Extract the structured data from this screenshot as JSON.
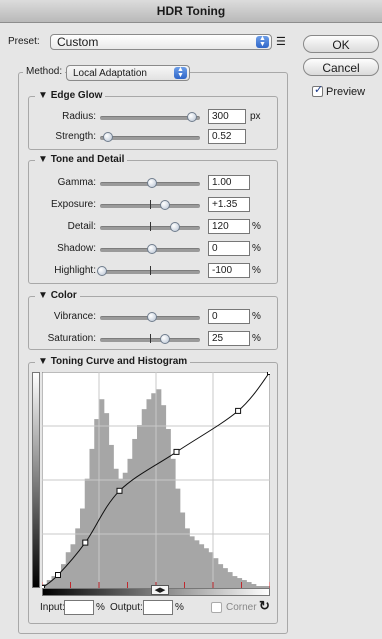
{
  "window": {
    "title": "HDR Toning"
  },
  "preset": {
    "label": "Preset:",
    "value": "Custom",
    "menu_icon": "list-menu-icon"
  },
  "buttons": {
    "ok": "OK",
    "cancel": "Cancel"
  },
  "preview": {
    "label": "Preview",
    "checked": true
  },
  "method": {
    "label": "Method:",
    "value": "Local Adaptation"
  },
  "edge_glow": {
    "title": "Edge Glow",
    "radius": {
      "label": "Radius:",
      "value": "300",
      "unit": "px",
      "slider_fraction": 0.9
    },
    "strength": {
      "label": "Strength:",
      "value": "0.52",
      "unit": "",
      "slider_fraction": 0.05
    }
  },
  "tone_detail": {
    "title": "Tone and Detail",
    "gamma": {
      "label": "Gamma:",
      "value": "1.00",
      "unit": "",
      "slider_fraction": 0.5
    },
    "exposure": {
      "label": "Exposure:",
      "value": "+1.35",
      "unit": "",
      "slider_fraction": 0.62
    },
    "detail": {
      "label": "Detail:",
      "value": "120",
      "unit": "%",
      "slider_fraction": 0.72
    },
    "shadow": {
      "label": "Shadow:",
      "value": "0",
      "unit": "%",
      "slider_fraction": 0.5
    },
    "highlight": {
      "label": "Highlight:",
      "value": "-100",
      "unit": "%",
      "slider_fraction": 0.0
    }
  },
  "color": {
    "title": "Color",
    "vibrance": {
      "label": "Vibrance:",
      "value": "0",
      "unit": "%",
      "slider_fraction": 0.5
    },
    "saturation": {
      "label": "Saturation:",
      "value": "25",
      "unit": "%",
      "slider_fraction": 0.62
    }
  },
  "curve": {
    "title": "Toning Curve and Histogram",
    "input_label": "Input:",
    "input_value": "",
    "input_unit": "%",
    "output_label": "Output:",
    "output_value": "",
    "output_unit": "%",
    "corner_label": "Corner",
    "reset_icon": "reset-icon",
    "points": [
      [
        0,
        0
      ],
      [
        7,
        6
      ],
      [
        19,
        21
      ],
      [
        34,
        45
      ],
      [
        59,
        63
      ],
      [
        86,
        82
      ],
      [
        100,
        100
      ]
    ],
    "histogram": [
      2,
      4,
      6,
      8,
      12,
      18,
      22,
      30,
      40,
      55,
      70,
      85,
      95,
      88,
      72,
      60,
      55,
      58,
      65,
      75,
      82,
      90,
      95,
      98,
      100,
      92,
      80,
      65,
      50,
      38,
      30,
      26,
      24,
      22,
      20,
      18,
      15,
      12,
      10,
      8,
      6,
      5,
      4,
      3,
      2,
      1,
      1,
      1
    ]
  },
  "colors": {
    "accent": "#3a6fd1",
    "histogram": "#a6a6a6",
    "curve": "#111111"
  }
}
